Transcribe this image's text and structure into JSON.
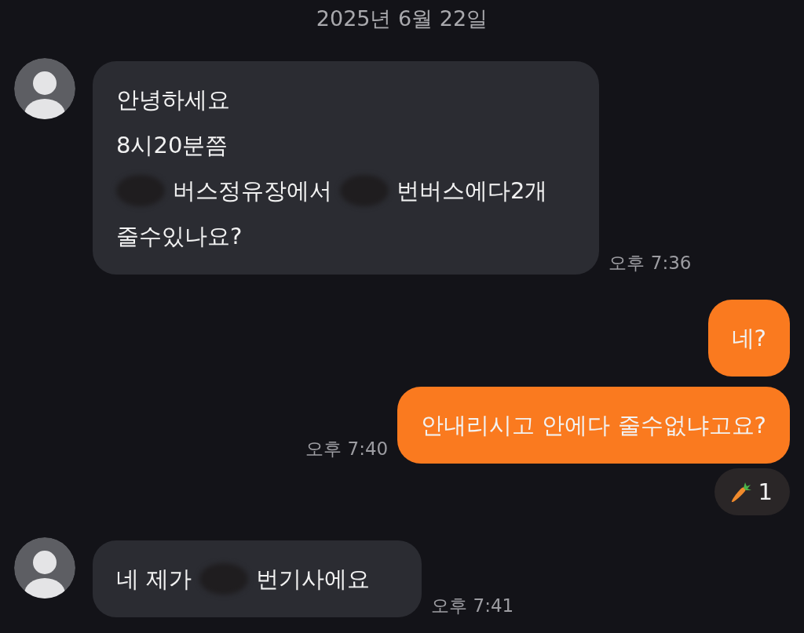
{
  "date_divider": "2025년 6월 22일",
  "messages": [
    {
      "kind": "incoming",
      "avatar": true,
      "lines": [
        [
          {
            "kind": "text",
            "text": "안녕하세요"
          }
        ],
        [
          {
            "kind": "text",
            "text": "8시20분쯤"
          }
        ],
        [
          {
            "kind": "redacted"
          },
          {
            "kind": "text",
            "text": "버스정유장에서"
          },
          {
            "kind": "redacted"
          },
          {
            "kind": "text",
            "text": "번버스에다2개"
          }
        ],
        [
          {
            "kind": "text",
            "text": "줄수있나요?"
          }
        ]
      ],
      "time": "오후 7:36"
    },
    {
      "kind": "outgoing",
      "lines": [
        [
          {
            "kind": "text",
            "text": "네?"
          }
        ]
      ]
    },
    {
      "kind": "outgoing",
      "lines": [
        [
          {
            "kind": "text",
            "text": "안내리시고 안에다 줄수없냐고요?"
          }
        ]
      ],
      "time": "오후 7:40",
      "reaction": {
        "count": "1"
      }
    },
    {
      "kind": "incoming",
      "avatar": true,
      "lines": [
        [
          {
            "kind": "text",
            "text": "네 제가"
          },
          {
            "kind": "redacted"
          },
          {
            "kind": "text",
            "text": "번기사에요"
          }
        ]
      ],
      "time": "오후 7:41"
    }
  ]
}
